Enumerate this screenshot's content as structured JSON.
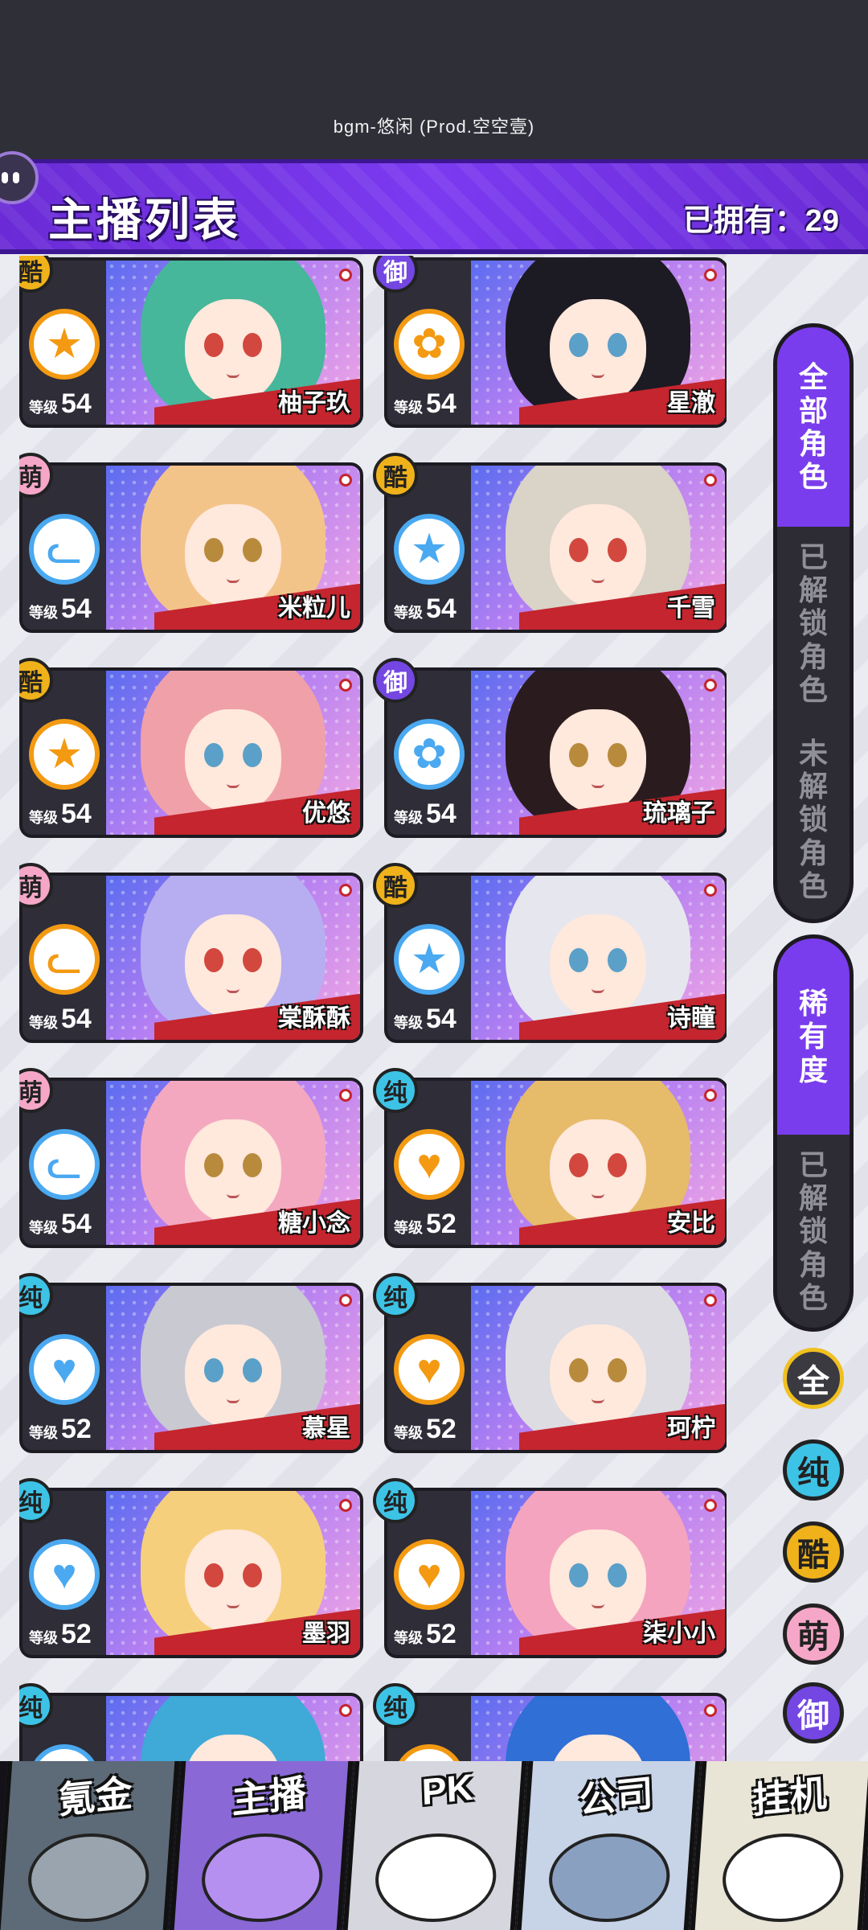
{
  "bgm_title": "bgm-悠闲 (Prod.空空壹)",
  "header": {
    "title": "主播列表",
    "owned": "已拥有：29"
  },
  "level_label": "等级",
  "characters": [
    {
      "name": "柚子玖",
      "level": "54",
      "rarity": "酷",
      "emblem_icon": "star-emblem-icon",
      "emblem_color": "#f39a12",
      "hair": "#46b79a"
    },
    {
      "name": "星澈",
      "level": "54",
      "rarity": "御",
      "emblem_icon": "rose-emblem-icon",
      "emblem_color": "#f39a12",
      "hair": "#1c1a22"
    },
    {
      "name": "米粒儿",
      "level": "54",
      "rarity": "萌",
      "emblem_icon": "cat-emblem-icon",
      "emblem_color": "#4aa9f0",
      "hair": "#f3c48a"
    },
    {
      "name": "千雪",
      "level": "54",
      "rarity": "酷",
      "emblem_icon": "star-emblem-icon",
      "emblem_color": "#4aa9f0",
      "hair": "#d9d3c8"
    },
    {
      "name": "优悠",
      "level": "54",
      "rarity": "酷",
      "emblem_icon": "star-emblem-icon",
      "emblem_color": "#f39a12",
      "hair": "#f0a0a8"
    },
    {
      "name": "琉璃子",
      "level": "54",
      "rarity": "御",
      "emblem_icon": "rose-emblem-icon",
      "emblem_color": "#4aa9f0",
      "hair": "#2a1c1e"
    },
    {
      "name": "棠酥酥",
      "level": "54",
      "rarity": "萌",
      "emblem_icon": "cat-emblem-icon",
      "emblem_color": "#f39a12",
      "hair": "#b6aef0"
    },
    {
      "name": "诗瞳",
      "level": "54",
      "rarity": "酷",
      "emblem_icon": "star-emblem-icon",
      "emblem_color": "#4aa9f0",
      "hair": "#e6e6ee"
    },
    {
      "name": "糖小念",
      "level": "54",
      "rarity": "萌",
      "emblem_icon": "cat-emblem-icon",
      "emblem_color": "#4aa9f0",
      "hair": "#f3a8c0"
    },
    {
      "name": "安比",
      "level": "52",
      "rarity": "纯",
      "emblem_icon": "pulse-emblem-icon",
      "emblem_color": "#f39a12",
      "hair": "#e6bb6a"
    },
    {
      "name": "慕星",
      "level": "52",
      "rarity": "纯",
      "emblem_icon": "pulse-emblem-icon",
      "emblem_color": "#4aa9f0",
      "hair": "#c9c9d2"
    },
    {
      "name": "珂柠",
      "level": "52",
      "rarity": "纯",
      "emblem_icon": "pulse-emblem-icon",
      "emblem_color": "#f39a12",
      "hair": "#dcdce2"
    },
    {
      "name": "墨羽",
      "level": "52",
      "rarity": "纯",
      "emblem_icon": "pulse-emblem-icon",
      "emblem_color": "#4aa9f0",
      "hair": "#f6cf7c"
    },
    {
      "name": "柒小小",
      "level": "52",
      "rarity": "纯",
      "emblem_icon": "pulse-emblem-icon",
      "emblem_color": "#f39a12",
      "hair": "#f4a4be"
    },
    {
      "name": "",
      "level": "",
      "rarity": "纯",
      "emblem_icon": "pulse-emblem-icon",
      "emblem_color": "#4aa9f0",
      "hair": "#3fa9d8"
    },
    {
      "name": "",
      "level": "",
      "rarity": "纯",
      "emblem_icon": "pulse-emblem-icon",
      "emblem_color": "#f39a12",
      "hair": "#2f6fd6"
    }
  ],
  "right_panel": {
    "roles_tab": {
      "all": "全部角色",
      "unlocked": "已解锁角色",
      "locked": "未解锁角色"
    },
    "rarity_tab": {
      "title": "稀有度",
      "unlocked": "已解锁角色"
    },
    "filters": [
      "全",
      "纯",
      "酷",
      "萌",
      "御"
    ]
  },
  "bottom_nav": [
    "氪金",
    "主播",
    "PK",
    "公司",
    "挂机"
  ],
  "colors": {
    "header": "#7b3af0",
    "ku": "#f0b21b",
    "yu": "#7446e2",
    "meng": "#f6a7c8",
    "chun": "#3dc3e6"
  }
}
